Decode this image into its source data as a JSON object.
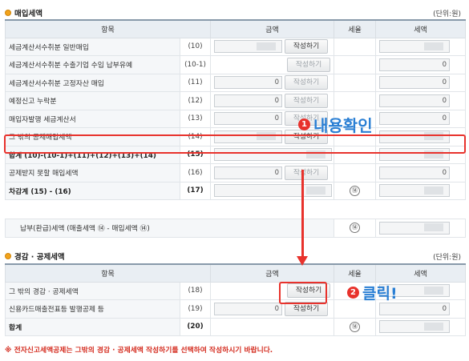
{
  "purchase": {
    "title": "매입세액",
    "unit": "(단위:원)",
    "headers": {
      "item": "항목",
      "amount": "금액",
      "rate": "세율",
      "tax": "세액"
    },
    "rows": [
      {
        "label": "세금계산서수취분 일반매입",
        "code": "(10)",
        "amount": "",
        "button": "작성하기",
        "tax": ""
      },
      {
        "label": "세금계산서수취분 수출기업 수입 납부유예",
        "code": "(10-1)",
        "amount": "",
        "button": "작성하기",
        "tax": "0"
      },
      {
        "label": "세금계산서수취분 고정자산 매입",
        "code": "(11)",
        "amount": "0",
        "button": "작성하기",
        "tax": "0"
      },
      {
        "label": "예정신고 누락분",
        "code": "(12)",
        "amount": "0",
        "button": "작성하기",
        "tax": "0"
      },
      {
        "label": "매입자발행 세금계산서",
        "code": "(13)",
        "amount": "0",
        "button": "작성하기",
        "tax": "0"
      },
      {
        "label": "그 밖의 공제매입세액",
        "code": "(14)",
        "amount": "",
        "button": "작성하기",
        "tax": ""
      },
      {
        "label": "합계 (10)-(10-1)+(11)+(12)+(13)+(14)",
        "code": "(15)",
        "amount": "",
        "tax": ""
      },
      {
        "label": "공제받지 못할 매입세액",
        "code": "(16)",
        "amount": "0",
        "button": "작성하기",
        "tax": "0"
      },
      {
        "label": "차감계 (15) - (16)",
        "code": "(17)",
        "amount": "",
        "rate_symbol": "⑭",
        "tax": ""
      }
    ],
    "payment_row": {
      "label": "납부(환급)세액 (매출세액 ⑭ - 매입세액 ⑭)",
      "symbol": "⑭",
      "tax": ""
    }
  },
  "deduction": {
    "title": "경감 · 공제세액",
    "unit": "(단위:원)",
    "headers": {
      "item": "항목",
      "amount": "금액",
      "rate": "세율",
      "tax": "세액"
    },
    "rows": [
      {
        "label": "그 밖의 경감 · 공제세액",
        "code": "(18)",
        "button": "작성하기",
        "tax": ""
      },
      {
        "label": "신용카드매출전표등 발행공제 등",
        "code": "(19)",
        "amount": "0",
        "button": "작성하기",
        "tax": "0"
      },
      {
        "label": "합계",
        "code": "(20)",
        "rate_symbol": "⑭",
        "tax": ""
      }
    ]
  },
  "annotations": {
    "step1_badge": "1",
    "step1_text": "내용확인",
    "step2_badge": "2",
    "step2_text": "클릭!"
  },
  "notice": "※ 전자신고세액공제는 그밖의 경감 · 공제세액 작성하기를 선택하여 작성하시기 바랍니다.",
  "colors": {
    "highlight": "#e8322c",
    "annotation_text": "#2a7fd4",
    "header_bg": "#e9eef3",
    "notice": "#d42b1e"
  }
}
